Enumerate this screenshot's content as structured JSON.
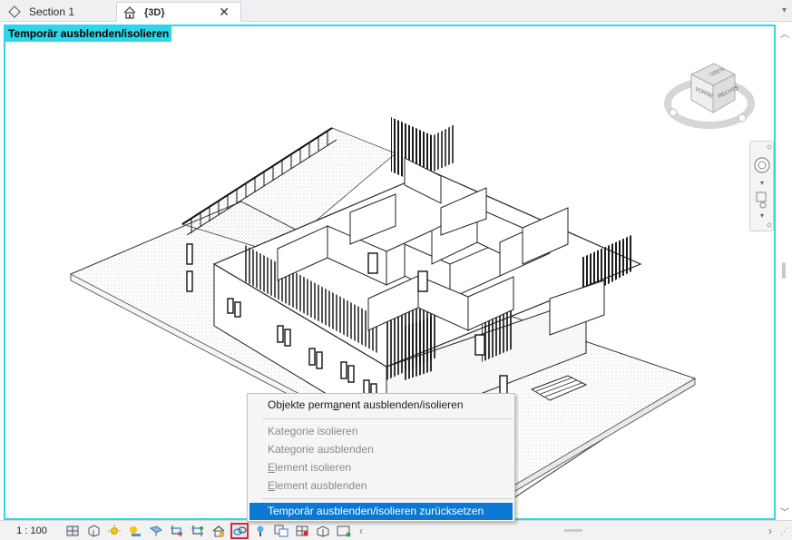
{
  "tabs": [
    {
      "label": "Section 1",
      "icon": "section-view-icon"
    },
    {
      "label": "{3D}",
      "icon": "home-3d-icon",
      "close": "✕"
    }
  ],
  "viewport": {
    "mode_label": "Temporär ausblenden/isolieren",
    "border_color": "#2fd6ea"
  },
  "viewcube": {
    "top_label": "OBEN",
    "front_label": "VORNE",
    "right_label": "RECHTS"
  },
  "statusbar": {
    "scale": "1 : 100",
    "icons": [
      "detail-level-icon",
      "visual-style-icon",
      "sun-path-icon",
      "shadows-icon",
      "render-icon",
      "crop-view-icon",
      "show-crop-icon",
      "unlock-3d-icon",
      "temporary-hide-isolate-icon",
      "reveal-hidden-icon",
      "worksharing-icon",
      "analytical-model-icon",
      "highlight-displacement-icon",
      "reveal-constraints-icon"
    ]
  },
  "context_menu": {
    "items": [
      {
        "label_pre": "Objekte perm",
        "accel": "a",
        "label_post": "nent ausblenden/isolieren",
        "state": "enabled"
      },
      {
        "label_pre": "",
        "accel": "",
        "label_post": "Kategorie isolieren",
        "state": "disabled"
      },
      {
        "label_pre": "",
        "accel": "",
        "label_post": "Kategorie ausblenden",
        "state": "disabled"
      },
      {
        "label_pre": "",
        "accel": "E",
        "label_post": "lement isolieren",
        "state": "disabled"
      },
      {
        "label_pre": "",
        "accel": "E",
        "label_post": "lement ausblenden",
        "state": "disabled"
      },
      {
        "label_pre": "",
        "accel": "",
        "label_post": "Temporär ausblenden/isolieren zurücksetzen",
        "state": "selected"
      }
    ]
  },
  "colors": {
    "accent": "#2fd6ea",
    "selection": "#0b78d4",
    "highlight_border": "#e2262b"
  }
}
